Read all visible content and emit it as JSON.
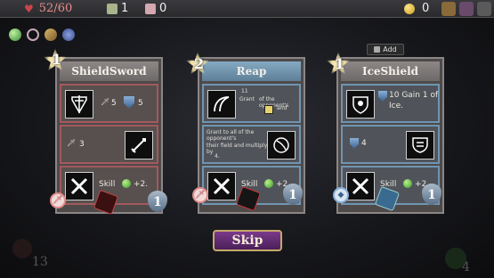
{
  "topbar": {
    "hp": "52/60",
    "potions": "1",
    "keys": "0",
    "gold": "0"
  },
  "cards": [
    {
      "name": "ShieldSword",
      "level": "1",
      "row1": {
        "sword_val": "5",
        "shield_val": "5"
      },
      "row2": {
        "sword_val": "3"
      },
      "row3": {
        "text": "Skill",
        "bonus": "+2."
      },
      "cost": "1"
    },
    {
      "name": "Reap",
      "level": "2",
      "row1": {
        "text_small": "11",
        "text": "Grant",
        "text2": "of the opponent's",
        "text3": "and"
      },
      "row2": {
        "text": "Grant",
        "text2": "to all of the opponent's",
        "text3": "their field and multiply by",
        "text4": "4."
      },
      "row3": {
        "text": "Skill",
        "bonus": "+2."
      },
      "cost": "1"
    },
    {
      "name": "IceShield",
      "level": "1",
      "row1": {
        "text": "10 Gain 1 of Ice."
      },
      "row2": {
        "shield_val": "4"
      },
      "row3": {
        "text": "Skill",
        "bonus": "+2."
      },
      "cost": "1"
    }
  ],
  "tooltip": {
    "add_label": "Add"
  },
  "skip_label": "Skip",
  "corner": {
    "left_num": "13",
    "right_num": "4"
  },
  "colors": {
    "hp": "#e98d8d",
    "attack_border": "#a3595e",
    "skill_border": "#6f95b2",
    "skip_bg": "#5a2a6a"
  }
}
